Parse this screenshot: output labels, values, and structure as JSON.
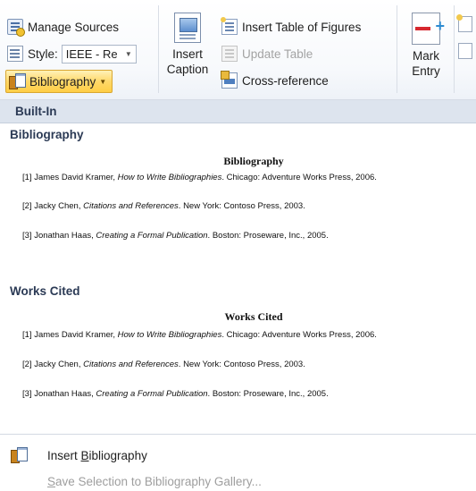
{
  "ribbon": {
    "manage_sources": "Manage Sources",
    "style_label": "Style:",
    "style_value": "IEEE - Re",
    "bibliography": "Bibliography",
    "insert_caption_line1": "Insert",
    "insert_caption_line2": "Caption",
    "insert_table_of_figures": "Insert Table of Figures",
    "update_table": "Update Table",
    "cross_reference": "Cross-reference",
    "mark_entry_line1": "Mark",
    "mark_entry_line2": "Entry"
  },
  "gallery": {
    "section_header": "Built-In",
    "items": [
      {
        "title": "Bibliography",
        "heading": "Bibliography",
        "entries": [
          {
            "pre": "[1] James David Kramer, ",
            "title": "How to Write Bibliographies",
            "post": ". Chicago: Adventure Works Press, 2006."
          },
          {
            "pre": "[2] Jacky Chen, ",
            "title": "Citations and References",
            "post": ". New York: Contoso Press, 2003."
          },
          {
            "pre": "[3] Jonathan Haas, ",
            "title": "Creating a Formal Publication",
            "post": ". Boston: Proseware, Inc., 2005."
          }
        ]
      },
      {
        "title": "Works Cited",
        "heading": "Works Cited",
        "entries": [
          {
            "pre": "[1] James David Kramer, ",
            "title": "How to Write Bibliographies",
            "post": ". Chicago: Adventure Works Press, 2006."
          },
          {
            "pre": "[2] Jacky Chen, ",
            "title": "Citations and References",
            "post": ". New York: Contoso Press, 2003."
          },
          {
            "pre": "[3] Jonathan Haas, ",
            "title": "Creating a Formal Publication",
            "post": ". Boston: Proseware, Inc., 2005."
          }
        ]
      }
    ]
  },
  "menu": {
    "insert_bibliography_pre": "Insert ",
    "insert_bibliography_accel": "B",
    "insert_bibliography_post": "ibliography",
    "save_selection_accel": "S",
    "save_selection_post": "ave Selection to Bibliography Gallery..."
  },
  "colors": {
    "ribbon_bg": "#f7f9fc",
    "bibliography_button_bg": "#ffd86a",
    "section_header_bg": "#dde4ee",
    "heading_text": "#2b3a55",
    "disabled_text": "#9e9e9e"
  }
}
